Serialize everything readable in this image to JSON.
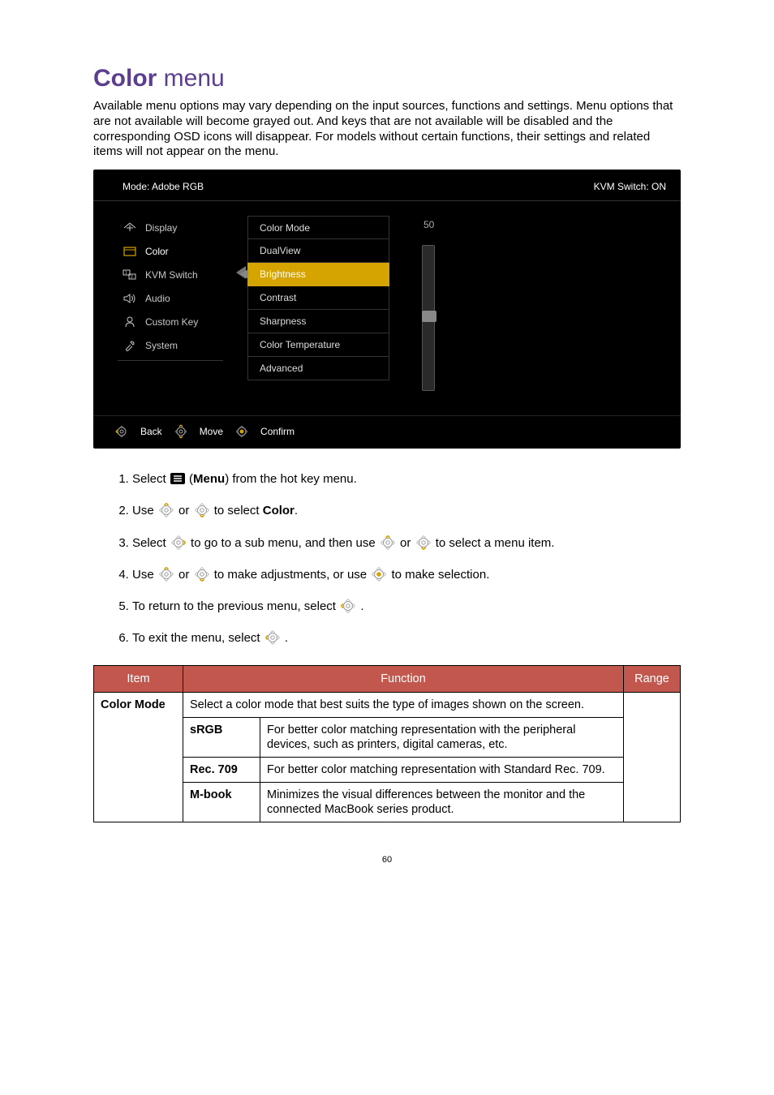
{
  "title": {
    "bold": "Color",
    "light": " menu"
  },
  "intro": "Available menu options may vary depending on the input sources, functions and settings. Menu options that are not available will become grayed out. And keys that are not available will be disabled and the corresponding OSD icons will disappear. For models without certain functions, their settings and related items will not appear on the menu.",
  "osd": {
    "mode_label": "Mode: Adobe RGB",
    "kvm_label": "KVM Switch: ON",
    "nav": {
      "display": "Display",
      "color": "Color",
      "kvm": "KVM Switch",
      "audio": "Audio",
      "custom": "Custom Key",
      "system": "System"
    },
    "sub": {
      "colormode": "Color Mode",
      "dualview": "DualView",
      "brightness": "Brightness",
      "contrast": "Contrast",
      "sharpness": "Sharpness",
      "colortemp": "Color Temperature",
      "advanced": "Advanced"
    },
    "value": "50",
    "footer": {
      "back": "Back",
      "move": "Move",
      "confirm": "Confirm"
    }
  },
  "steps": {
    "s1a": "Select ",
    "s1b": " (",
    "s1c": "Menu",
    "s1d": ") from the hot key menu.",
    "s2a": "Use ",
    "s2b": " or ",
    "s2c": " to select ",
    "s2d": "Color",
    "s2e": ".",
    "s3a": "Select ",
    "s3b": " to go to a sub menu, and then use ",
    "s3c": " or ",
    "s3d": " to select a menu item.",
    "s4a": "Use ",
    "s4b": " or ",
    "s4c": " to make adjustments, or use ",
    "s4d": " to make selection.",
    "s5a": "To return to the previous menu, select ",
    "s5b": ".",
    "s6a": "To exit the menu, select ",
    "s6b": "."
  },
  "table": {
    "headers": {
      "item": "Item",
      "function": "Function",
      "range": "Range"
    },
    "item1": "Color Mode",
    "desc1": "Select a color mode that best suits the type of images shown on the screen.",
    "r1": {
      "name": "sRGB",
      "desc": "For better color matching representation with the peripheral devices, such as printers, digital cameras, etc."
    },
    "r2": {
      "name": "Rec. 709",
      "desc": "For better color matching representation with Standard Rec. 709."
    },
    "r3": {
      "name": "M-book",
      "desc": "Minimizes the visual differences between the monitor and the connected MacBook series product."
    }
  },
  "page": "60"
}
